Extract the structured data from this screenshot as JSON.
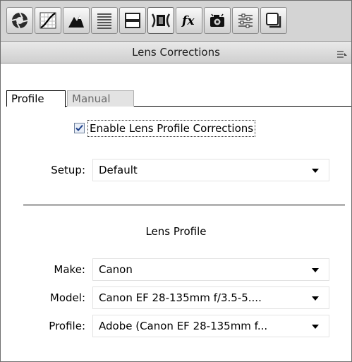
{
  "toolbar": {
    "tools": [
      {
        "icon": "basic-aperture-icon"
      },
      {
        "icon": "tone-curve-icon"
      },
      {
        "icon": "detail-icon"
      },
      {
        "icon": "hsl-grayscale-icon"
      },
      {
        "icon": "split-toning-icon"
      },
      {
        "icon": "lens-corrections-icon",
        "active": true
      },
      {
        "icon": "fx-effects-icon",
        "label": "fx"
      },
      {
        "icon": "camera-calibration-icon"
      },
      {
        "icon": "presets-icon"
      },
      {
        "icon": "snapshots-icon"
      }
    ]
  },
  "panel": {
    "title": "Lens Corrections",
    "menu_icon": "panel-menu-icon"
  },
  "tabs": [
    {
      "label": "Profile",
      "selected": true
    },
    {
      "label": "Manual",
      "selected": false
    }
  ],
  "enable_profile": {
    "label": "Enable Lens Profile Corrections",
    "checked": true
  },
  "setup": {
    "label": "Setup:",
    "value": "Default"
  },
  "lens_profile": {
    "title": "Lens Profile",
    "make": {
      "label": "Make:",
      "value": "Canon"
    },
    "model": {
      "label": "Model:",
      "value": "Canon EF 28-135mm f/3.5-5...."
    },
    "profile": {
      "label": "Profile:",
      "value": "Adobe (Canon EF 28-135mm f..."
    }
  }
}
